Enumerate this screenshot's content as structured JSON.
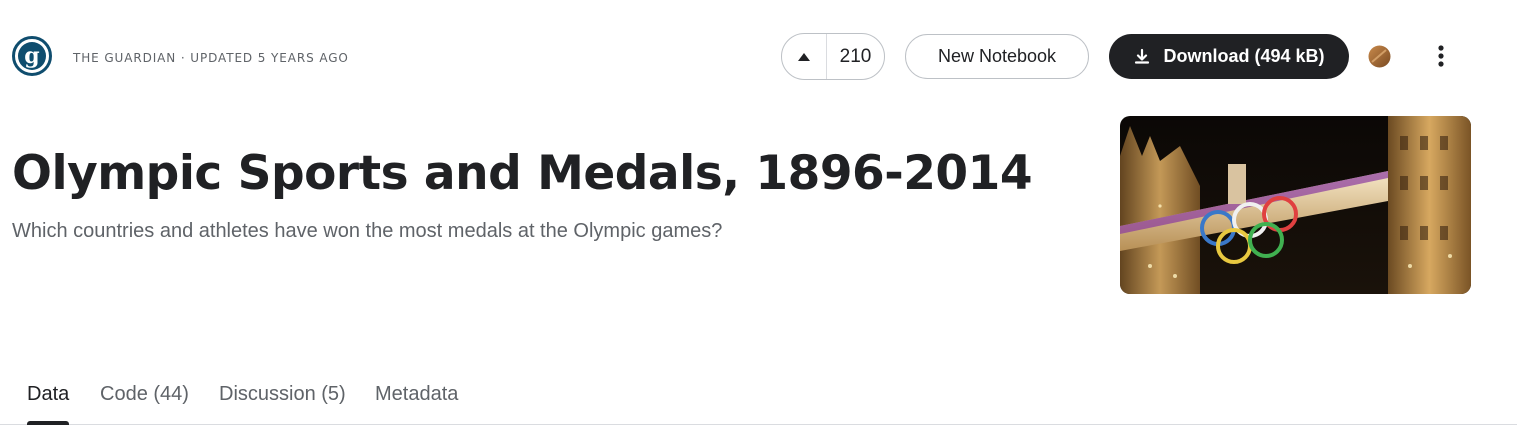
{
  "header": {
    "owner_icon": "guardian-logo-icon",
    "owner_line": "THE GUARDIAN · UPDATED 5 YEARS AGO"
  },
  "actions": {
    "upvote_icon": "caret-up-icon",
    "vote_count": "210",
    "new_notebook_label": "New Notebook",
    "download_icon": "download-icon",
    "download_label": "Download (494 kB)",
    "user_avatar_icon": "user-avatar-icon",
    "more_icon": "more-vertical-icon"
  },
  "dataset": {
    "title": "Olympic Sports and Medals, 1896-2014",
    "subtitle": "Which countries and athletes have won the most medals at the Olympic games?",
    "cover_image": "tower-bridge-olympic-rings-image"
  },
  "tabs": [
    {
      "label": "Data",
      "active": true
    },
    {
      "label": "Code (44)",
      "active": false
    },
    {
      "label": "Discussion (5)",
      "active": false
    },
    {
      "label": "Metadata",
      "active": false
    }
  ],
  "colors": {
    "primary_text": "#202124",
    "secondary_text": "#5f6368",
    "dark_button": "#202124",
    "border": "#bdc1c6",
    "brand_blue": "#0f4d6e"
  }
}
